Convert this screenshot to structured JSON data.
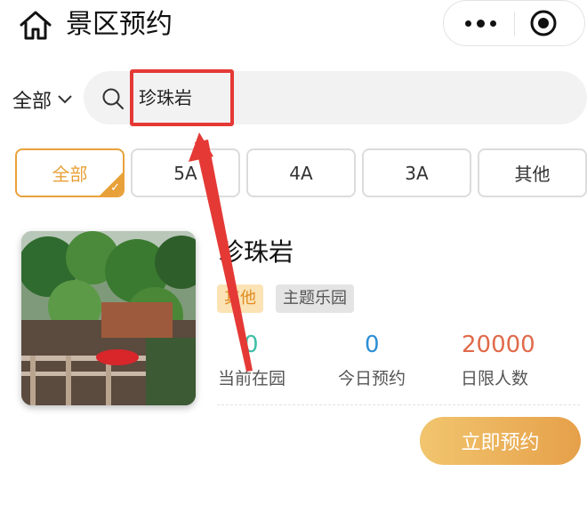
{
  "header": {
    "title": "景区预约",
    "home_icon": "home-icon",
    "more_icon": "more-dots-icon",
    "close_icon": "target-close-icon"
  },
  "search": {
    "scope_label": "全部",
    "query": "珍珠岩"
  },
  "filters": [
    {
      "label": "全部",
      "active": true
    },
    {
      "label": "5A",
      "active": false
    },
    {
      "label": "4A",
      "active": false
    },
    {
      "label": "3A",
      "active": false
    },
    {
      "label": "其他",
      "active": false
    }
  ],
  "scenic_spot": {
    "name": "珍珠岩",
    "level_tag": "其他",
    "type_tag": "主题乐园",
    "stats": [
      {
        "value": "0",
        "label": "当前在园",
        "color": "#3dbfa6"
      },
      {
        "value": "0",
        "label": "今日预约",
        "color": "#2d8fd5"
      },
      {
        "value": "20000",
        "label": "日限人数",
        "color": "#e06a4a"
      }
    ],
    "book_label": "立即预约"
  },
  "colors": {
    "accent": "#e8a13a",
    "annotation": "#e53935"
  }
}
